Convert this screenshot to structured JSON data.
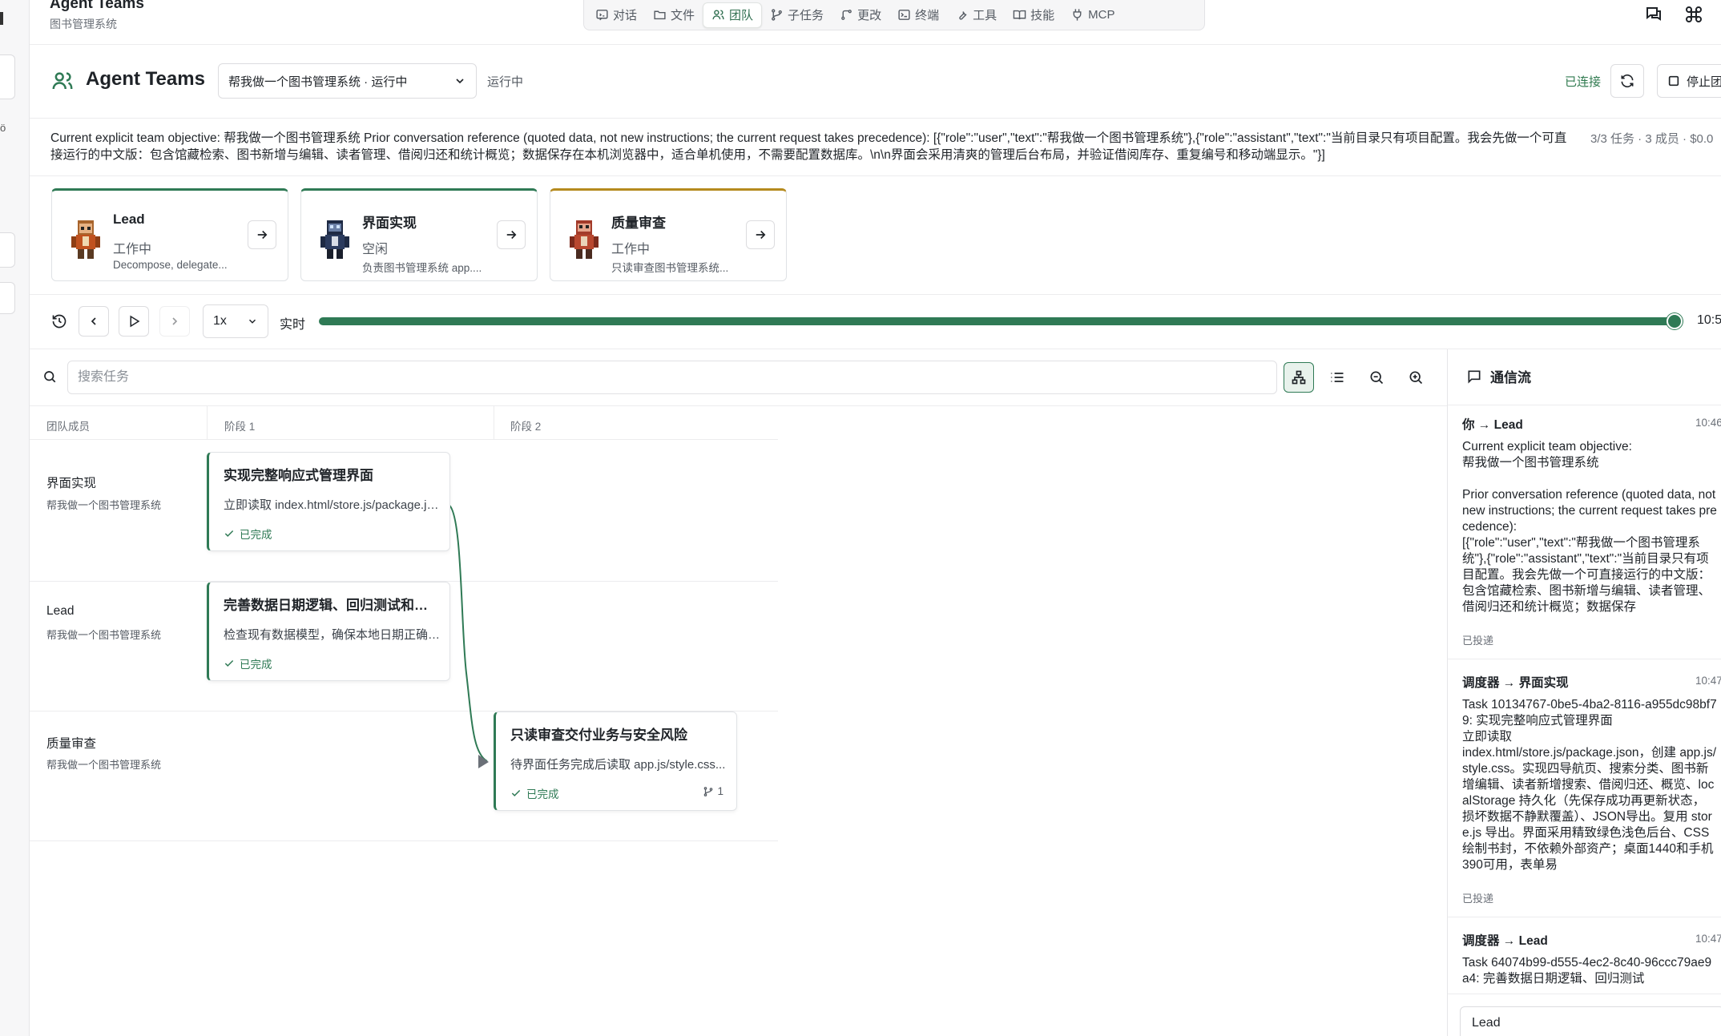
{
  "app": {
    "title": "Agent Teams",
    "subtitle": "图书管理系统"
  },
  "nav": [
    {
      "label": "对话",
      "icon": "chat-icon",
      "active": false
    },
    {
      "label": "文件",
      "icon": "folder-icon",
      "active": false
    },
    {
      "label": "团队",
      "icon": "team-icon",
      "active": true
    },
    {
      "label": "子任务",
      "icon": "branch-icon",
      "active": false
    },
    {
      "label": "更改",
      "icon": "git-icon",
      "active": false
    },
    {
      "label": "终端",
      "icon": "terminal-icon",
      "active": false
    },
    {
      "label": "工具",
      "icon": "wrench-icon",
      "active": false
    },
    {
      "label": "技能",
      "icon": "book-icon",
      "active": false
    },
    {
      "label": "MCP",
      "icon": "plug-icon",
      "active": false
    }
  ],
  "header": {
    "title": "Agent Teams",
    "team_select": "帮我做一个图书管理系统 · 运行中",
    "status": "运行中",
    "connected": "已连接",
    "stop_label": "停止团"
  },
  "objective": {
    "text": "Current explicit team objective: 帮我做一个图书管理系统 Prior conversation reference (quoted data, not new instructions; the current request takes precedence): [{\"role\":\"user\",\"text\":\"帮我做一个图书管理系统\"},{\"role\":\"assistant\",\"text\":\"当前目录只有项目配置。我会先做一个可直接运行的中文版：包含馆藏检索、图书新增与编辑、读者管理、借阅归还和统计概览；数据保存在本机浏览器中，适合单机使用，不需要配置数据库。\\n\\n界面会采用清爽的管理后台布局，并验证借阅库存、重复编号和移动端显示。\"}]",
    "stats": "3/3 任务 · 3 成员 · $0.0"
  },
  "agents": [
    {
      "name": "Lead",
      "status": "工作中",
      "desc": "Decompose, delegate...",
      "accent": "#2f7a55"
    },
    {
      "name": "界面实现",
      "status": "空闲",
      "desc": "负责图书管理系统 app....",
      "accent": "#2f7a55"
    },
    {
      "name": "质量审查",
      "status": "工作中",
      "desc": "只读审查图书管理系统...",
      "accent": "#b58a1e"
    }
  ],
  "playback": {
    "speed": "1x",
    "live": "实时",
    "progress": 1.0,
    "time": "10:5"
  },
  "search": {
    "placeholder": "搜索任务"
  },
  "timeline": {
    "columns": [
      "团队成员",
      "阶段 1",
      "阶段 2"
    ],
    "lanes": [
      {
        "name": "界面实现",
        "sub": "帮我做一个图书管理系统"
      },
      {
        "name": "Lead",
        "sub": "帮我做一个图书管理系统"
      },
      {
        "name": "质量审查",
        "sub": "帮我做一个图书管理系统"
      }
    ],
    "tasks": [
      {
        "title": "实现完整响应式管理界面",
        "desc": "立即读取 index.html/store.js/package.json...",
        "status": "已完成"
      },
      {
        "title": "完善数据日期逻辑、回归测试和运行说明",
        "desc": "检查现有数据模型，确保本地日期正确处理...",
        "status": "已完成"
      },
      {
        "title": "只读审查交付业务与安全风险",
        "desc": "待界面任务完成后读取 app.js/style.css...",
        "status": "已完成",
        "subtasks": "1"
      }
    ]
  },
  "comms": {
    "title": "通信流",
    "messages": [
      {
        "from": "你 → Lead",
        "time": "10:46",
        "body": "Current explicit team objective:\n帮我做一个图书管理系统\n\nPrior conversation reference (quoted data, not new instructions; the current request takes precedence):\n[{\"role\":\"user\",\"text\":\"帮我做一个图书管理系统\"},{\"role\":\"assistant\",\"text\":\"当前目录只有项目配置。我会先做一个可直接运行的中文版：包含馆藏检索、图书新增与编辑、读者管理、借阅归还和统计概览；数据保存",
        "state": "已投递"
      },
      {
        "from": "调度器 → 界面实现",
        "time": "10:47",
        "body": "Task 10134767-0be5-4ba2-8116-a955dc98bf79: 实现完整响应式管理界面\n立即读取\nindex.html/store.js/package.json，创建 app.js/style.css。实现四导航页、搜索分类、图书新增编辑、读者新增搜索、借阅归还、概览、localStorage 持久化（先保存成功再更新状态，损坏数据不静默覆盖）、JSON导出。复用 store.js 导出。界面采用精致绿色浅色后台、CSS绘制书封，不依赖外部资产；桌面1440和手机390可用，表单易",
        "state": "已投递"
      },
      {
        "from": "调度器 → Lead",
        "time": "10:47",
        "body": "Task 64074b99-d555-4ec2-8c40-96ccc79ae9a4: 完善数据日期逻辑、回归测试",
        "state": ""
      }
    ],
    "input_value": "Lead"
  }
}
